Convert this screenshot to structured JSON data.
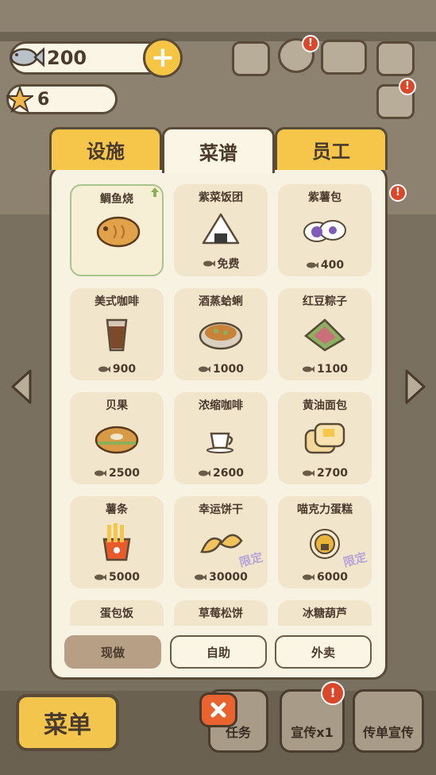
{
  "hud": {
    "coins": "200",
    "stars": "6",
    "plus_label": "+"
  },
  "tabs": [
    {
      "label": "设施",
      "active": false
    },
    {
      "label": "菜谱",
      "active": true
    },
    {
      "label": "员工",
      "active": false
    }
  ],
  "recipes": [
    {
      "name": "鲷鱼烧",
      "price": "",
      "selected": true,
      "limited": false,
      "icon": "taiyaki-icon"
    },
    {
      "name": "紫菜饭团",
      "price": "免费",
      "selected": false,
      "limited": false,
      "icon": "onigiri-icon"
    },
    {
      "name": "紫薯包",
      "price": "400",
      "selected": false,
      "limited": false,
      "icon": "purple-bun-icon"
    },
    {
      "name": "美式咖啡",
      "price": "900",
      "selected": false,
      "limited": false,
      "icon": "americano-icon"
    },
    {
      "name": "酒蒸蛤蜊",
      "price": "1000",
      "selected": false,
      "limited": false,
      "icon": "clams-icon"
    },
    {
      "name": "红豆粽子",
      "price": "1100",
      "selected": false,
      "limited": false,
      "icon": "zongzi-icon"
    },
    {
      "name": "贝果",
      "price": "2500",
      "selected": false,
      "limited": false,
      "icon": "bagel-icon"
    },
    {
      "name": "浓缩咖啡",
      "price": "2600",
      "selected": false,
      "limited": false,
      "icon": "espresso-icon"
    },
    {
      "name": "黄油面包",
      "price": "2700",
      "selected": false,
      "limited": false,
      "icon": "butter-bread-icon"
    },
    {
      "name": "薯条",
      "price": "5000",
      "selected": false,
      "limited": false,
      "icon": "fries-icon"
    },
    {
      "name": "幸运饼干",
      "price": "30000",
      "selected": false,
      "limited": true,
      "icon": "fortune-cookie-icon"
    },
    {
      "name": "喵克力蛋糕",
      "price": "6000",
      "selected": false,
      "limited": true,
      "icon": "cat-cake-icon"
    },
    {
      "name": "蛋包饭",
      "price": "",
      "selected": false,
      "limited": false,
      "icon": "omurice-icon"
    },
    {
      "name": "草莓松饼",
      "price": "",
      "selected": false,
      "limited": false,
      "icon": "strawberry-muffin-icon"
    },
    {
      "name": "冰糖葫芦",
      "price": "",
      "selected": false,
      "limited": false,
      "icon": "tanghulu-icon"
    }
  ],
  "limited_label": "限定",
  "modes": [
    {
      "label": "现做",
      "active": true
    },
    {
      "label": "自助",
      "active": false
    },
    {
      "label": "外卖",
      "active": false
    }
  ],
  "bottom": {
    "menu_label": "菜单",
    "tasks_label": "任务",
    "promo_label": "宣传x1",
    "flyer_label": "传单宣传"
  },
  "colors": {
    "tab_yellow": "#f5c64a",
    "panel_bg": "#f8f2e2",
    "card_bg": "#f1e6cc",
    "active_mode": "#b79f86",
    "notification_red": "#d9482b"
  }
}
